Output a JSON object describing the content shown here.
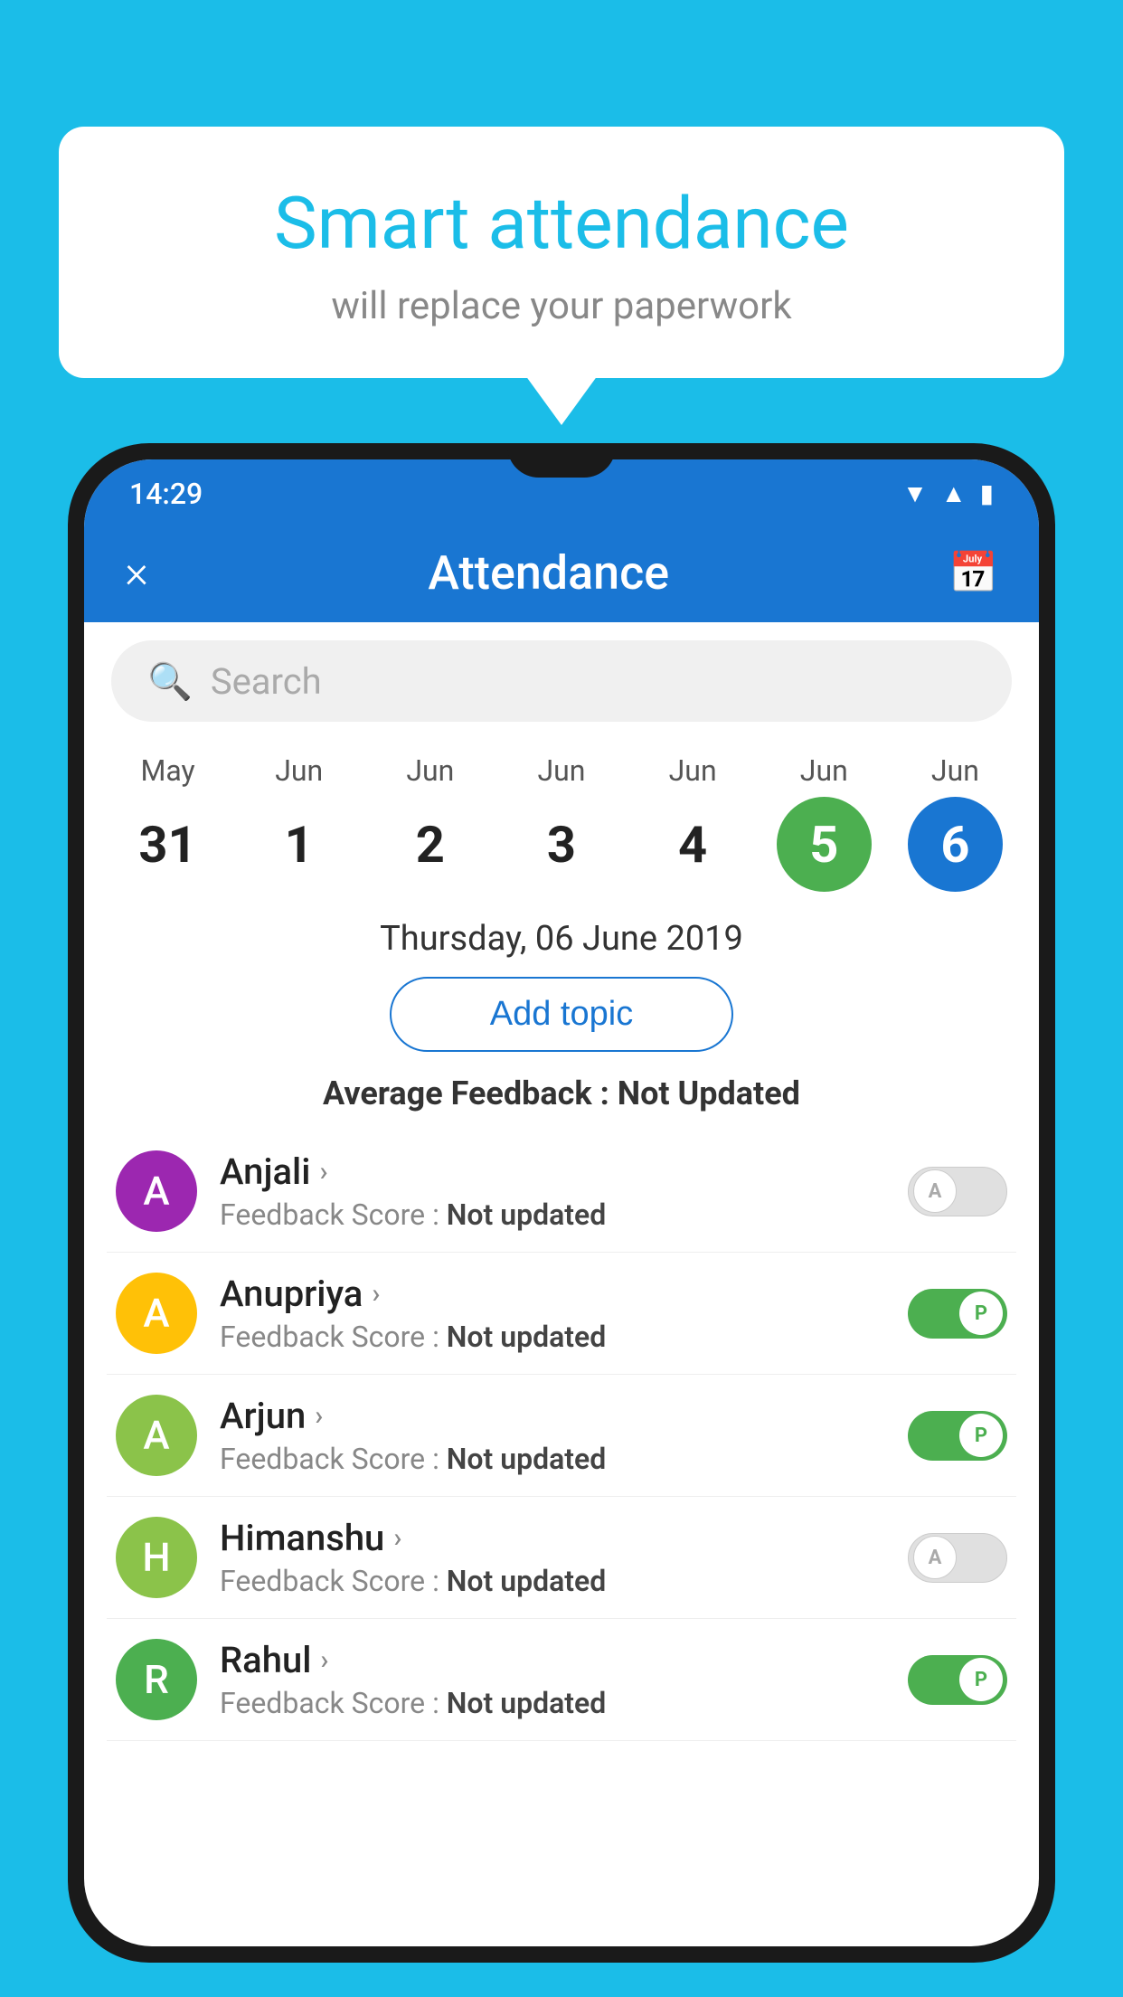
{
  "background_color": "#1BBDE8",
  "bubble": {
    "title": "Smart attendance",
    "subtitle": "will replace your paperwork"
  },
  "status_bar": {
    "time": "14:29",
    "icons": [
      "wifi",
      "signal",
      "battery"
    ]
  },
  "app_bar": {
    "title": "Attendance",
    "close_label": "×",
    "calendar_label": "📅"
  },
  "search": {
    "placeholder": "Search"
  },
  "calendar": {
    "days": [
      {
        "month": "May",
        "date": "31",
        "state": "normal"
      },
      {
        "month": "Jun",
        "date": "1",
        "state": "normal"
      },
      {
        "month": "Jun",
        "date": "2",
        "state": "normal"
      },
      {
        "month": "Jun",
        "date": "3",
        "state": "normal"
      },
      {
        "month": "Jun",
        "date": "4",
        "state": "normal"
      },
      {
        "month": "Jun",
        "date": "5",
        "state": "today"
      },
      {
        "month": "Jun",
        "date": "6",
        "state": "selected"
      }
    ],
    "selected_date_label": "Thursday, 06 June 2019"
  },
  "add_topic_label": "Add topic",
  "avg_feedback_label": "Average Feedback : ",
  "avg_feedback_value": "Not Updated",
  "students": [
    {
      "initial": "A",
      "name": "Anjali",
      "feedback_label": "Feedback Score : ",
      "feedback_value": "Not updated",
      "avatar_color": "#9C27B0",
      "attendance": "absent"
    },
    {
      "initial": "A",
      "name": "Anupriya",
      "feedback_label": "Feedback Score : ",
      "feedback_value": "Not updated",
      "avatar_color": "#FFC107",
      "attendance": "present"
    },
    {
      "initial": "A",
      "name": "Arjun",
      "feedback_label": "Feedback Score : ",
      "feedback_value": "Not updated",
      "avatar_color": "#8BC34A",
      "attendance": "present"
    },
    {
      "initial": "H",
      "name": "Himanshu",
      "feedback_label": "Feedback Score : ",
      "feedback_value": "Not updated",
      "avatar_color": "#8BC34A",
      "attendance": "absent"
    },
    {
      "initial": "R",
      "name": "Rahul",
      "feedback_label": "Feedback Score : ",
      "feedback_value": "Not updated",
      "avatar_color": "#4CAF50",
      "attendance": "present"
    }
  ]
}
